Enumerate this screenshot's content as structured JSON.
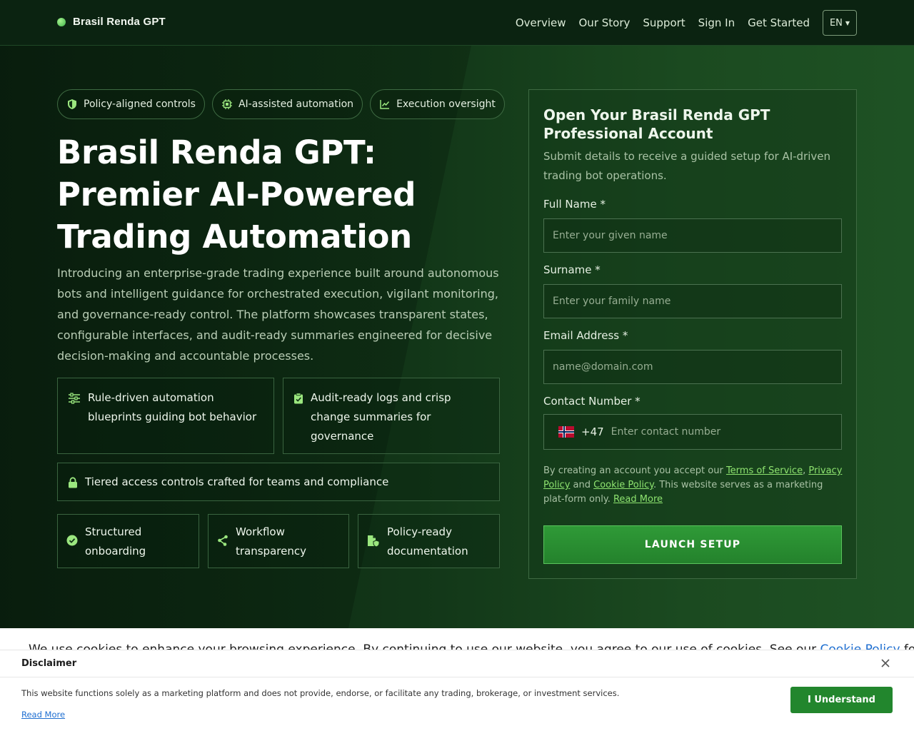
{
  "header": {
    "brand": "Brasil Renda GPT",
    "nav": [
      "Overview",
      "Our Story",
      "Support",
      "Sign In",
      "Get Started"
    ],
    "lang": "EN"
  },
  "chips": [
    {
      "label": "Policy-aligned controls",
      "icon": "shield-icon"
    },
    {
      "label": "AI-assisted automation",
      "icon": "chip-icon"
    },
    {
      "label": "Execution oversight",
      "icon": "chart-line-icon"
    }
  ],
  "hero": {
    "title": "Brasil Renda GPT: Premier AI-Powered Trading Automation",
    "lead": "Introducing an enterprise-grade trading experience built around autonomous bots and intelligent guidance for orchestrated execution, vigilant monitoring, and governance-ready control. The platform showcases transparent states, configurable interfaces, and audit-ready summaries engineered for decisive decision-making and accountable processes."
  },
  "features": [
    {
      "label": "Rule-driven automation blueprints guiding bot behavior",
      "icon": "sliders-icon"
    },
    {
      "label": "Audit-ready logs and crisp change summaries for governance",
      "icon": "clipboard-check-icon"
    },
    {
      "label": "Tiered access controls crafted for teams and compliance",
      "icon": "lock-icon"
    },
    {
      "label": "Structured onboarding",
      "icon": "check-circle-icon"
    },
    {
      "label": "Workflow transparency",
      "icon": "share-nodes-icon"
    },
    {
      "label": "Policy-ready documentation",
      "icon": "file-shield-icon"
    }
  ],
  "form": {
    "title": "Open Your Brasil Renda GPT Professional Account",
    "subtitle": "Submit details to receive a guided setup for AI-driven trading bot operations.",
    "fields": [
      {
        "label": "Full Name *",
        "placeholder": "Enter your given name"
      },
      {
        "label": "Surname *",
        "placeholder": "Enter your family name"
      },
      {
        "label": "Email Address *",
        "placeholder": "name@domain.com"
      },
      {
        "label": "Contact Number *",
        "placeholder": "Enter contact number"
      }
    ],
    "dial_code": "+47",
    "terms": {
      "prefix": "By creating an account you accept our ",
      "tos": "Terms of Service",
      "comma": ", ",
      "privacy": "Privacy Policy",
      "and": " and ",
      "cookie": "Cookie Policy",
      "suffix": ". This website serves as a marketing plat-form only. ",
      "more": "Read More"
    },
    "submit": "LAUNCH SETUP"
  },
  "cookie": {
    "text": "We use cookies to enhance your browsing experience. By continuing to use our website, you agree to our use of cookies. See our ",
    "link": "Cookie Policy",
    "tail": " for more informa"
  },
  "disclaimer": {
    "title": "Disclaimer",
    "text": "This website functions solely as a marketing platform and does not provide, endorse, or facilitate any trading, brokerage, or investment services.",
    "more": "Read More",
    "button": "I Understand"
  },
  "colors": {
    "accent": "#8ee36f",
    "button": "#2f9a37",
    "background": "#0d2a12"
  }
}
